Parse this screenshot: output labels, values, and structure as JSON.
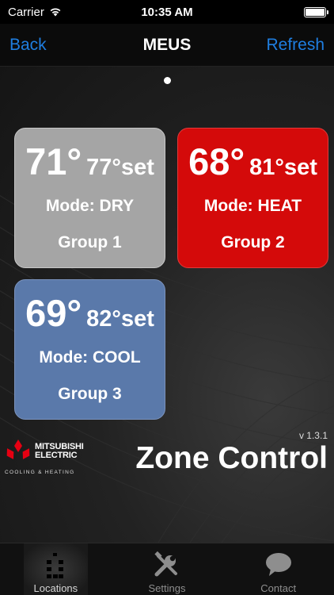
{
  "status_bar": {
    "carrier": "Carrier",
    "time": "10:35 AM"
  },
  "nav": {
    "back_label": "Back",
    "title": "MEUS",
    "refresh_label": "Refresh"
  },
  "pager": {
    "current_page": 1,
    "page_count": 1
  },
  "zones": [
    {
      "current": "71°",
      "set": "77°set",
      "mode": "Mode: DRY",
      "group": "Group 1",
      "color": "#a5a5a5"
    },
    {
      "current": "68°",
      "set": "81°set",
      "mode": "Mode: HEAT",
      "group": "Group 2",
      "color": "#d40a0a"
    },
    {
      "current": "69°",
      "set": "82°set",
      "mode": "Mode: COOL",
      "group": "Group 3",
      "color": "#5a79aa"
    }
  ],
  "footer": {
    "version": "v 1.3.1",
    "brand_line1": "MITSUBISHI",
    "brand_line2": "ELECTRIC",
    "brand_sub": "COOLING & HEATING",
    "product": "Zone Control"
  },
  "tabs": [
    {
      "label": "Locations",
      "icon": "building-icon",
      "active": true
    },
    {
      "label": "Settings",
      "icon": "tools-icon",
      "active": false
    },
    {
      "label": "Contact",
      "icon": "chat-bubble-icon",
      "active": false
    }
  ],
  "colors": {
    "accent": "#1f7ee0",
    "brand_red": "#e60012"
  }
}
